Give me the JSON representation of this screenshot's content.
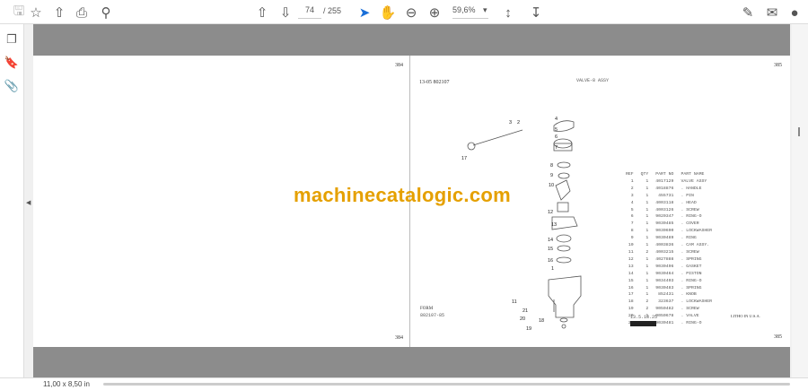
{
  "toolbar": {
    "current_page": "74",
    "total_pages": "/ 255",
    "zoom": "59,6%"
  },
  "status": {
    "page_size": "11,00 x 8,50 in"
  },
  "document": {
    "left_page_number_top": "384",
    "left_page_number_bottom": "384",
    "right_page_number_top": "385",
    "right_page_number_bottom": "385",
    "section": "13-05  802107",
    "title": "VALVE-8  ASSY",
    "form_label": "FORM",
    "form_number": "802107-85",
    "print_code": "13.5.18.25",
    "litho": "LITHO IN U.S.A.",
    "watermark": "machinecatalogic.com",
    "parts_headers": [
      "REF",
      "QTY",
      "PART NO",
      "PART NAME"
    ],
    "parts": [
      [
        "1",
        "1",
        "4017129",
        "VALVE ASSY"
      ],
      [
        "2",
        "1",
        "4018876",
        ". HANDLE"
      ],
      [
        "3",
        "1",
        "455731",
        ". PIN"
      ],
      [
        "4",
        "1",
        "4003118",
        ". HEAD"
      ],
      [
        "5",
        "1",
        "4003126",
        ". SCREW"
      ],
      [
        "6",
        "1",
        "9020347",
        ". RING-O"
      ],
      [
        "7",
        "1",
        "9030485",
        ". COVER"
      ],
      [
        "8",
        "1",
        "9030690",
        ". LOCKWASHER"
      ],
      [
        "9",
        "1",
        "9030489",
        ". RING"
      ],
      [
        "10",
        "1",
        "4003836",
        ". CAM ASSY."
      ],
      [
        "11",
        "2",
        "4003215",
        ". SCREW"
      ],
      [
        "12",
        "1",
        "4027888",
        ". SPRING"
      ],
      [
        "13",
        "1",
        "9030496",
        ". GASKET"
      ],
      [
        "14",
        "1",
        "9030464",
        ". PISTON"
      ],
      [
        "15",
        "1",
        "9034403",
        ". RING-O"
      ],
      [
        "16",
        "1",
        "9030483",
        ". SPRING"
      ],
      [
        "17",
        "1",
        "852431",
        ". KNOB"
      ],
      [
        "18",
        "2",
        "323637",
        ". LOCKWASHER"
      ],
      [
        "19",
        "2",
        "9050482",
        ". SCREW"
      ],
      [
        "20",
        "1",
        "9050678",
        ". VALVE"
      ],
      [
        "21",
        "1",
        "9030481",
        ". RING-O"
      ]
    ],
    "callouts": [
      "1",
      "2",
      "3",
      "4",
      "5",
      "6",
      "7",
      "8",
      "9",
      "10",
      "11",
      "12",
      "13",
      "14",
      "15",
      "16",
      "17",
      "18",
      "19",
      "20",
      "21"
    ]
  }
}
